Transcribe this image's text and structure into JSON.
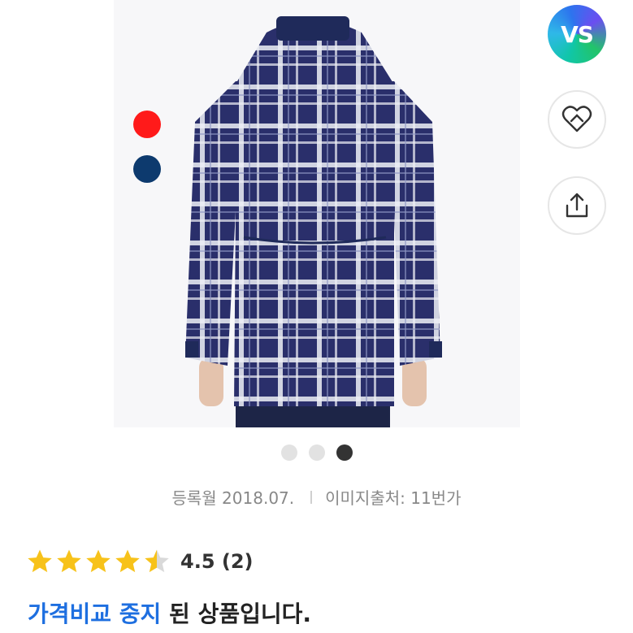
{
  "colors": {
    "accent": "#1e6fe0",
    "star": "#f7c21a",
    "swatch_red": "#ff1a1a",
    "swatch_navy": "#0d3a6e",
    "plaid_navy": "#2a2f6b"
  },
  "product_image": {
    "alt": "navy plaid hooded jacket (back view)"
  },
  "swatches": [
    {
      "name": "red",
      "color": "#ff1a1a"
    },
    {
      "name": "navy",
      "color": "#0d3a6e"
    }
  ],
  "fab": {
    "vs_label": "VS",
    "wish_icon": "heart-icon",
    "share_icon": "share-icon"
  },
  "carousel": {
    "count": 3,
    "active_index": 2
  },
  "meta": {
    "registered": "등록월 2018.07.",
    "source": "이미지출처: 11번가"
  },
  "rating": {
    "score": "4.5",
    "count": "(2)",
    "stars": 4.5
  },
  "notice": {
    "highlight": "가격비교 중지",
    "rest": " 된 상품입니다."
  }
}
